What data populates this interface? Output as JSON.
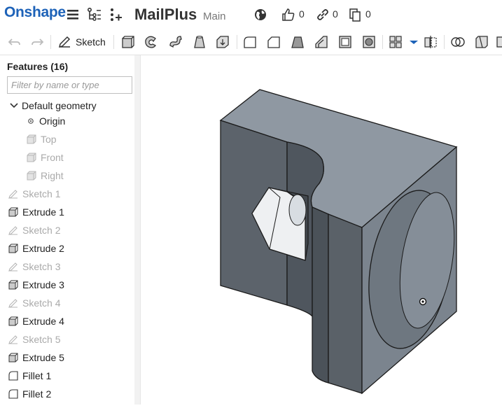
{
  "header": {
    "logo": "Onshape",
    "title": "MailPlus",
    "branch": "Main",
    "likes": "0",
    "links": "0",
    "copies": "0"
  },
  "toolbar": {
    "sketch_label": "Sketch"
  },
  "features": {
    "title": "Features (16)",
    "filter_placeholder": "Filter by name or type",
    "default_geometry": "Default geometry",
    "origin": "Origin",
    "planes": [
      "Top",
      "Front",
      "Right"
    ],
    "items": [
      {
        "label": "Sketch 1",
        "kind": "sketch"
      },
      {
        "label": "Extrude 1",
        "kind": "extrude"
      },
      {
        "label": "Sketch 2",
        "kind": "sketch"
      },
      {
        "label": "Extrude 2",
        "kind": "extrude"
      },
      {
        "label": "Sketch 3",
        "kind": "sketch"
      },
      {
        "label": "Extrude 3",
        "kind": "extrude"
      },
      {
        "label": "Sketch 4",
        "kind": "sketch"
      },
      {
        "label": "Extrude 4",
        "kind": "extrude"
      },
      {
        "label": "Sketch 5",
        "kind": "sketch"
      },
      {
        "label": "Extrude 5",
        "kind": "extrude"
      },
      {
        "label": "Fillet 1",
        "kind": "fillet"
      },
      {
        "label": "Fillet 2",
        "kind": "fillet"
      }
    ]
  },
  "colors": {
    "brand": "#1d62b8",
    "model_top": "#8c96a0",
    "model_front": "#5d646c",
    "model_side": "#79828c"
  }
}
